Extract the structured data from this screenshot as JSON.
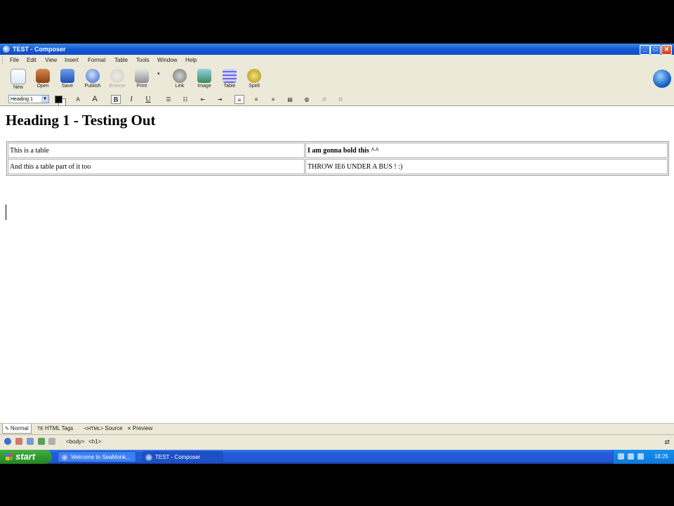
{
  "window": {
    "title": "TEST - Composer"
  },
  "menu": [
    "File",
    "Edit",
    "View",
    "Insert",
    "Format",
    "Table",
    "Tools",
    "Window",
    "Help"
  ],
  "toolbar": [
    {
      "label": "New",
      "icon": "new-page-icon",
      "enabled": true
    },
    {
      "label": "Open",
      "icon": "open-folder-icon",
      "enabled": true
    },
    {
      "label": "Save",
      "icon": "save-disk-icon",
      "enabled": true
    },
    {
      "label": "Publish",
      "icon": "publish-globe-icon",
      "enabled": true
    },
    {
      "label": "Browse",
      "icon": "browse-icon",
      "enabled": false
    },
    {
      "label": "Print",
      "icon": "printer-icon",
      "enabled": true
    },
    {
      "label": "Link",
      "icon": "link-icon",
      "enabled": true
    },
    {
      "label": "Image",
      "icon": "image-icon",
      "enabled": true
    },
    {
      "label": "Table",
      "icon": "table-icon",
      "enabled": true
    },
    {
      "label": "Spell",
      "icon": "spell-check-icon",
      "enabled": true
    }
  ],
  "format": {
    "paragraph_style": "Heading 1",
    "bold": "B",
    "italic": "I",
    "underline": "U",
    "smaller_font": "A",
    "larger_font": "A"
  },
  "document": {
    "heading": "Heading 1 - Testing Out",
    "table": [
      [
        "This is a table",
        "I am gonna bold this ^^"
      ],
      [
        "And this a table part of it too",
        "THROW IE6 UNDER A BUS ! :)"
      ]
    ]
  },
  "mode_tabs": [
    {
      "label": "Normal",
      "glyph": "✎",
      "active": true
    },
    {
      "label": "HTML Tags",
      "glyph": "TE",
      "active": false
    },
    {
      "label": "Source",
      "glyph": "<HTML>",
      "active": false
    },
    {
      "label": "Preview",
      "glyph": "✕",
      "active": false
    }
  ],
  "status": {
    "structure": [
      "<body>",
      "<h1>"
    ]
  },
  "taskbar": {
    "start_label": "start",
    "items": [
      {
        "label": "Welcome to SeaMonk...",
        "active": false
      },
      {
        "label": "TEST - Composer",
        "active": true
      }
    ],
    "clock": "18:25"
  },
  "colors": {
    "titlebar": "#0f4cc4",
    "taskbar": "#245edb",
    "start": "#2f9a2f",
    "chrome": "#ece9d8"
  }
}
